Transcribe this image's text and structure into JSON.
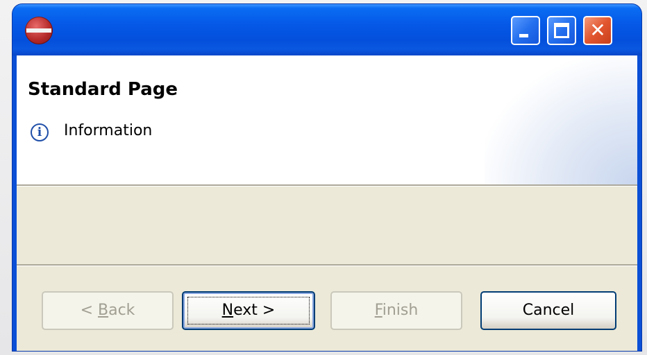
{
  "window": {
    "title": "",
    "titlebar_color": "#0558e6",
    "controls": {
      "minimize_icon": "minimize-icon",
      "maximize_icon": "maximize-icon",
      "close_icon": "close-icon",
      "close_glyph": "✕"
    }
  },
  "header": {
    "title": "Standard Page",
    "message": "Information",
    "message_icon": "info-icon",
    "info_glyph": "i"
  },
  "buttons": {
    "back": {
      "prefix": "< ",
      "mnemonic": "B",
      "rest": "ack",
      "enabled": false
    },
    "next": {
      "mnemonic": "N",
      "rest": "ext >",
      "enabled": true,
      "default": true
    },
    "finish": {
      "mnemonic": "F",
      "rest": "inish",
      "enabled": false
    },
    "cancel": {
      "label": "Cancel",
      "enabled": true
    }
  },
  "colors": {
    "dialog_background": "#ece9d8",
    "banner_background": "#ffffff",
    "disabled_text": "#a19f93"
  }
}
